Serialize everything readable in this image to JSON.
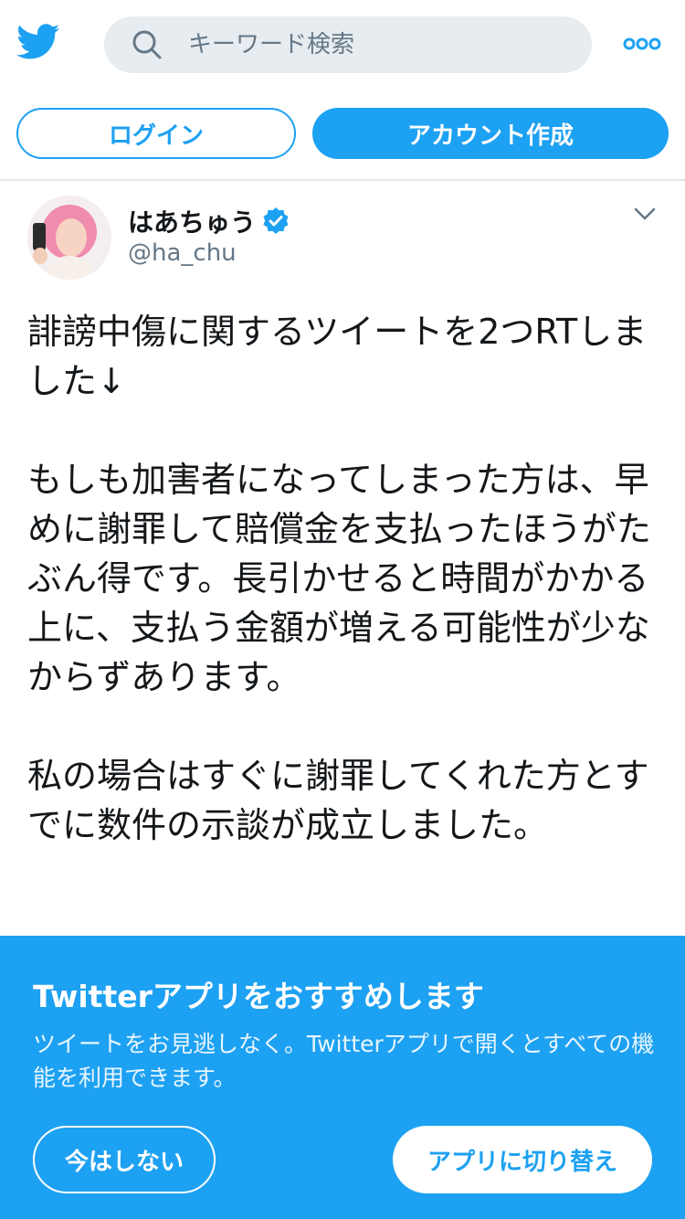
{
  "colors": {
    "brand": "#1da1f2",
    "text": "#14171a",
    "secondary": "#657786",
    "search_bg": "#e6ecf0",
    "divider": "#e1e8ed"
  },
  "header": {
    "logo_icon": "twitter-bird-icon",
    "search_icon": "search-icon",
    "search_placeholder": "キーワード検索",
    "more_icon": "more-dots-icon"
  },
  "auth": {
    "login_label": "ログイン",
    "signup_label": "アカウント作成"
  },
  "tweet": {
    "display_name": "はあちゅう",
    "verified": true,
    "handle": "@ha_chu",
    "text": "誹謗中傷に関するツイートを2つRTしました↓\n\nもしも加害者になってしまった方は、早めに謝罪して賠償金を支払ったほうがたぶん得です。長引かせると時間がかかる上に、支払う金額が増える可能性が少なからずあります。\n\n私の場合はすぐに謝罪してくれた方とすでに数件の示談が成立しました。"
  },
  "promo": {
    "title": "Twitterアプリをおすすめします",
    "description": "ツイートをお見逃しなく。Twitterアプリで開くとすべての機能を利用できます。",
    "not_now_label": "今はしない",
    "switch_label": "アプリに切り替え"
  }
}
